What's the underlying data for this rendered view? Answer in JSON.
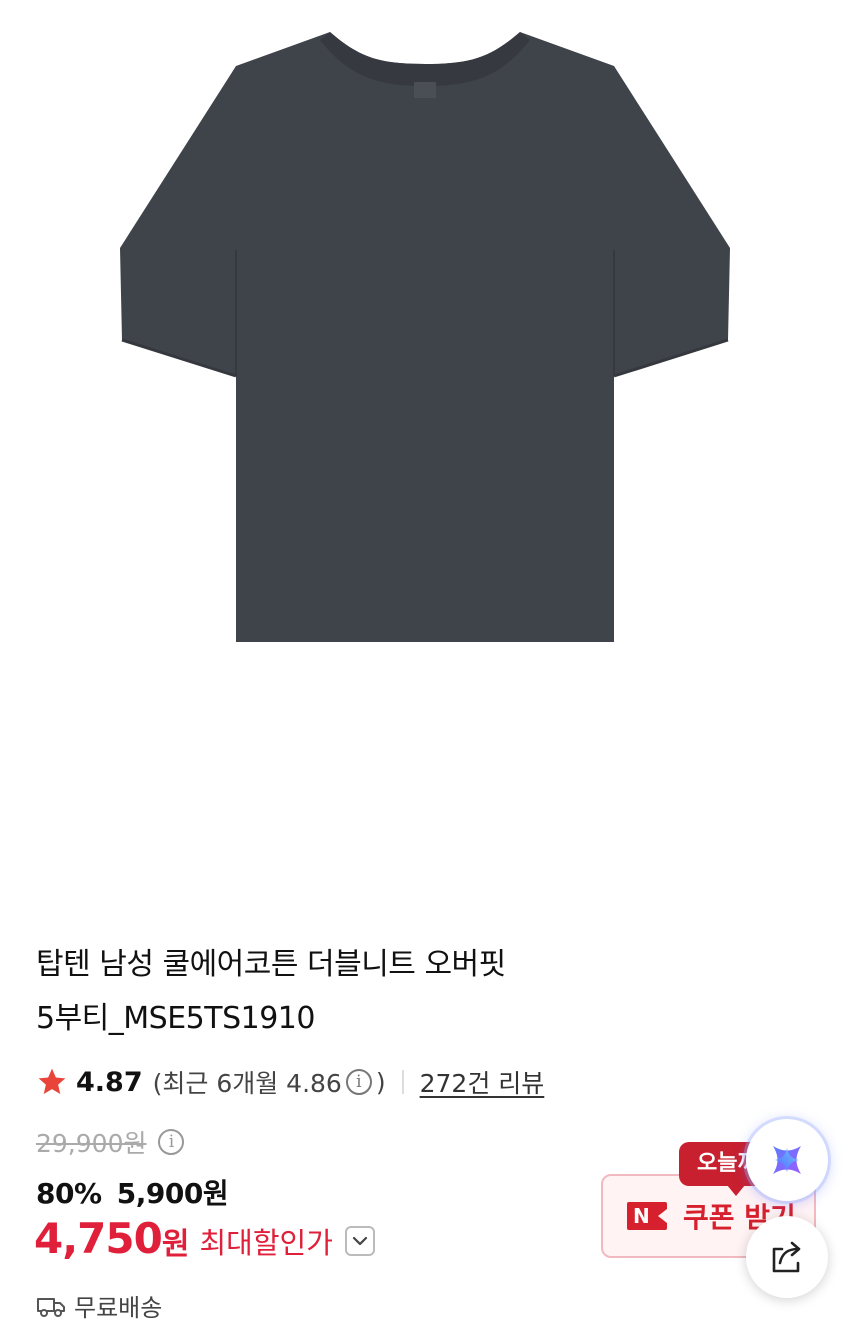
{
  "product": {
    "image_alt": "charcoal oversized t-shirt",
    "image_color": "#3f434a",
    "title_line1": "탑텐 남성 쿨에어코튼 더블니트 오버핏",
    "title_line2": "5부티_MSE5TS1910"
  },
  "rating": {
    "score": "4.87",
    "recent_open": "(최근 6개월 4.86",
    "recent_close": ")",
    "info_symbol": "i",
    "review_link": "272건 리뷰",
    "star_color": "#e8443a"
  },
  "price": {
    "original": "29,900원",
    "discount_rate": "80%",
    "sale_price": "5,900원",
    "best_price": "4,750",
    "best_unit": "원",
    "best_label": "최대할인가",
    "accent_color": "#e0203a"
  },
  "shipping": {
    "label": "무료배송"
  },
  "coupon": {
    "badge": "오늘까",
    "logo_letter": "N",
    "label": "쿠폰 받기"
  },
  "icons": {
    "star": "star-icon",
    "info": "info-icon",
    "chevron": "chevron-down-icon",
    "truck": "truck-icon",
    "ai": "ai-assistant-icon",
    "share": "share-icon"
  }
}
